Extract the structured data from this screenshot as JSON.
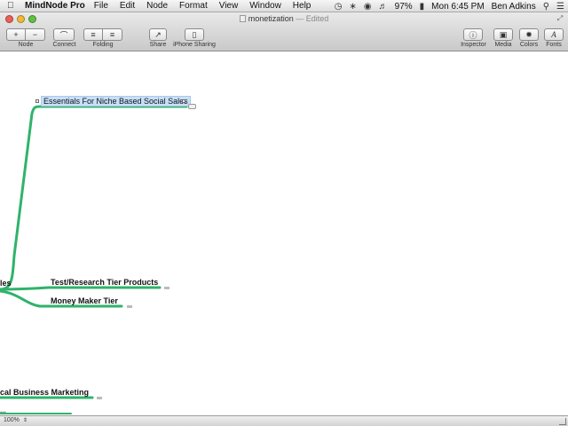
{
  "menubar": {
    "app_name": "MindNode Pro",
    "items": [
      "File",
      "Edit",
      "Node",
      "Format",
      "View",
      "Window",
      "Help"
    ],
    "battery": "97%",
    "clock": "Mon 6:45 PM",
    "user": "Ben Adkins"
  },
  "window": {
    "doc_name": "monetization",
    "edited": "— Edited"
  },
  "toolbar": {
    "node_add": "+",
    "node_remove": "−",
    "node_label": "Node",
    "connect_label": "Connect",
    "folding_label": "Folding",
    "share_label": "Share",
    "iphone_label": "iPhone Sharing",
    "inspector_label": "Inspector",
    "media_label": "Media",
    "colors_label": "Colors",
    "fonts_label": "Fonts"
  },
  "mindmap": {
    "branch_color": "#2fb36b",
    "selection_color": "#c7dff8",
    "nodes": {
      "essentials": "Essentials For Niche Based Social Sales",
      "root_partial": "les",
      "test_research": "Test/Research Tier Products",
      "money_maker": "Money Maker Tier",
      "local_business": "cal Business Marketing",
      "bottom_partial": "..."
    }
  },
  "statusbar": {
    "zoom": "100%"
  }
}
